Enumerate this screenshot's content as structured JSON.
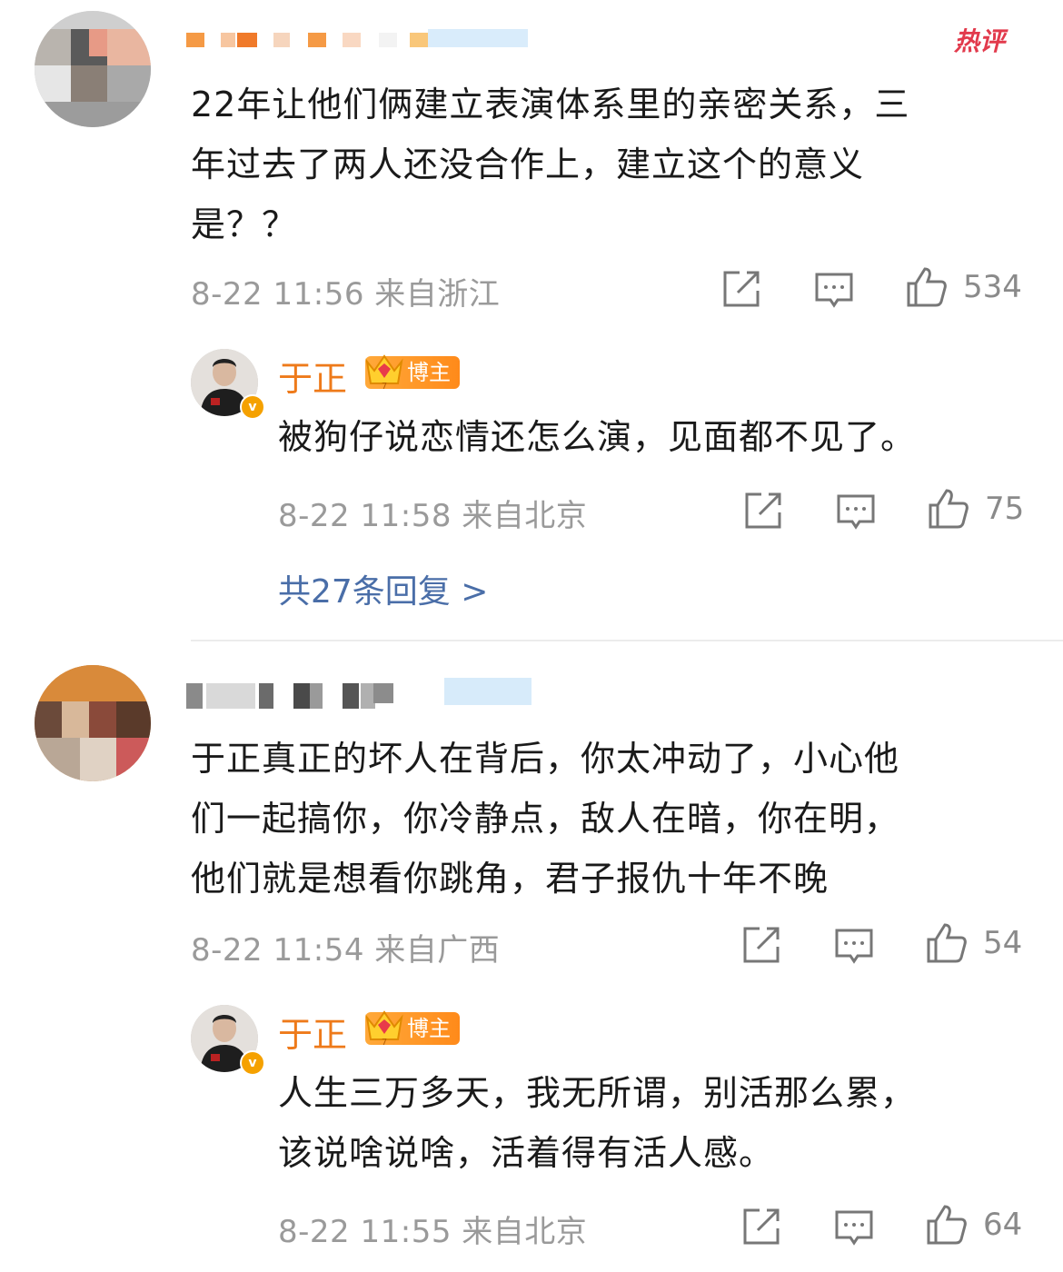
{
  "hot_label": "热评",
  "comments": [
    {
      "text_lines": [
        "22年让他们俩建立表演体系里的亲密关系，三",
        "年过去了两人还没合作上，建立这个的意义",
        "是？？"
      ],
      "meta": "8-22 11:56 来自浙江",
      "likes": "534",
      "reply": {
        "author": "于正",
        "badge": "博主",
        "text_lines": [
          "被狗仔说恋情还怎么演，见面都不见了。"
        ],
        "meta": "8-22 11:58 来自北京",
        "likes": "75"
      },
      "more_replies": "共27条回复 >"
    },
    {
      "text_lines": [
        "于正真正的坏人在背后，你太冲动了，小心他",
        "们一起搞你，你冷静点，敌人在暗，你在明，",
        "他们就是想看你跳角，君子报仇十年不晚"
      ],
      "meta": "8-22 11:54 来自广西",
      "likes": "54",
      "reply": {
        "author": "于正",
        "badge": "博主",
        "text_lines": [
          "人生三万多天，我无所谓，别活那么累，",
          "该说啥说啥，活着得有活人感。"
        ],
        "meta": "8-22 11:55 来自北京",
        "likes": "64"
      }
    }
  ]
}
